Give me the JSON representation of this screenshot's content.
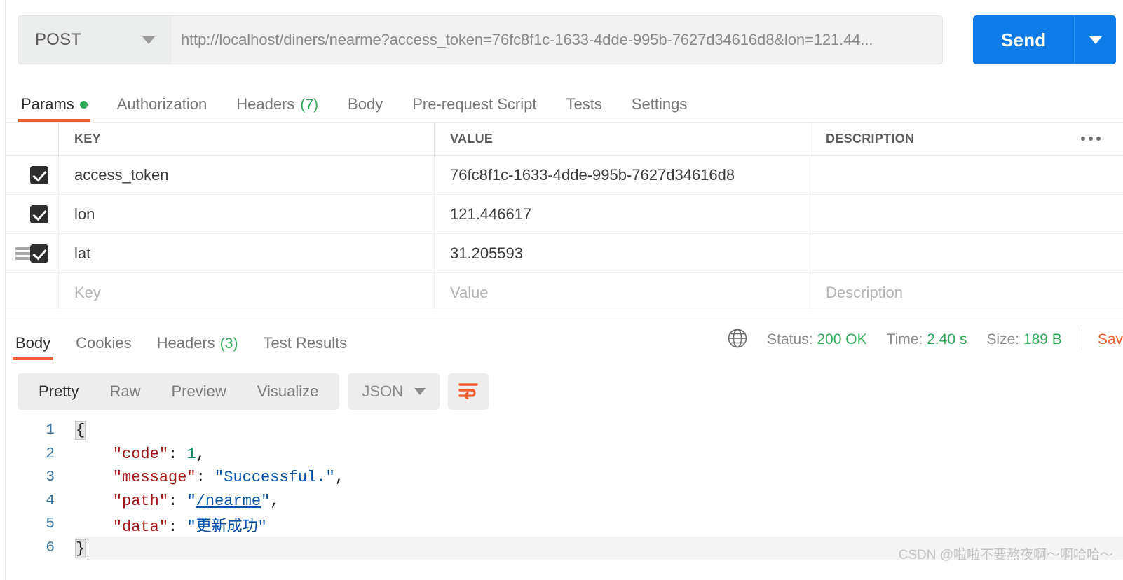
{
  "request": {
    "method": "POST",
    "url": "http://localhost/diners/nearme?access_token=76fc8f1c-1633-4dde-995b-7627d34616d8&lon=121.44...",
    "send_label": "Send",
    "tabs": [
      {
        "label": "Params",
        "badge": "",
        "dot": true,
        "active": true
      },
      {
        "label": "Authorization",
        "badge": "",
        "dot": false,
        "active": false
      },
      {
        "label": "Headers",
        "badge": "(7)",
        "dot": false,
        "active": false
      },
      {
        "label": "Body",
        "badge": "",
        "dot": false,
        "active": false
      },
      {
        "label": "Pre-request Script",
        "badge": "",
        "dot": false,
        "active": false
      },
      {
        "label": "Tests",
        "badge": "",
        "dot": false,
        "active": false
      },
      {
        "label": "Settings",
        "badge": "",
        "dot": false,
        "active": false
      }
    ]
  },
  "params": {
    "columns": {
      "key": "KEY",
      "value": "VALUE",
      "description": "DESCRIPTION"
    },
    "rows": [
      {
        "checked": true,
        "key": "access_token",
        "value": "76fc8f1c-1633-4dde-995b-7627d34616d8",
        "description": ""
      },
      {
        "checked": true,
        "key": "lon",
        "value": "121.446617",
        "description": ""
      },
      {
        "checked": true,
        "key": "lat",
        "value": "31.205593",
        "description": ""
      }
    ],
    "placeholder_row": {
      "key": "Key",
      "value": "Value",
      "description": "Description"
    }
  },
  "response": {
    "tabs": [
      {
        "label": "Body",
        "badge": "",
        "active": true
      },
      {
        "label": "Cookies",
        "badge": "",
        "active": false
      },
      {
        "label": "Headers",
        "badge": "(3)",
        "active": false
      },
      {
        "label": "Test Results",
        "badge": "",
        "active": false
      }
    ],
    "status_label": "Status:",
    "status_value": "200 OK",
    "time_label": "Time:",
    "time_value": "2.40 s",
    "size_label": "Size:",
    "size_value": "189 B",
    "save_label": "Sav",
    "viewer": {
      "modes": [
        {
          "label": "Pretty",
          "active": true
        },
        {
          "label": "Raw",
          "active": false
        },
        {
          "label": "Preview",
          "active": false
        },
        {
          "label": "Visualize",
          "active": false
        }
      ],
      "format": "JSON"
    },
    "body_lines": [
      "1",
      "2",
      "3",
      "4",
      "5",
      "6"
    ],
    "body": {
      "code": "1",
      "message": "Successful.",
      "path": "/nearme",
      "data": "更新成功",
      "key_code": "\"code\"",
      "key_message": "\"message\"",
      "key_path": "\"path\"",
      "key_data": "\"data\"",
      "open_brace": "{",
      "close_brace": "}"
    }
  },
  "watermark": "CSDN @啦啦不要熬夜啊～啊哈哈～",
  "colors": {
    "accent_orange": "#ef6031",
    "send_blue": "#0d7ce8",
    "status_green": "#2eaa5a",
    "json_key": "#a31515",
    "json_string": "#0451a5",
    "json_number": "#098658"
  }
}
